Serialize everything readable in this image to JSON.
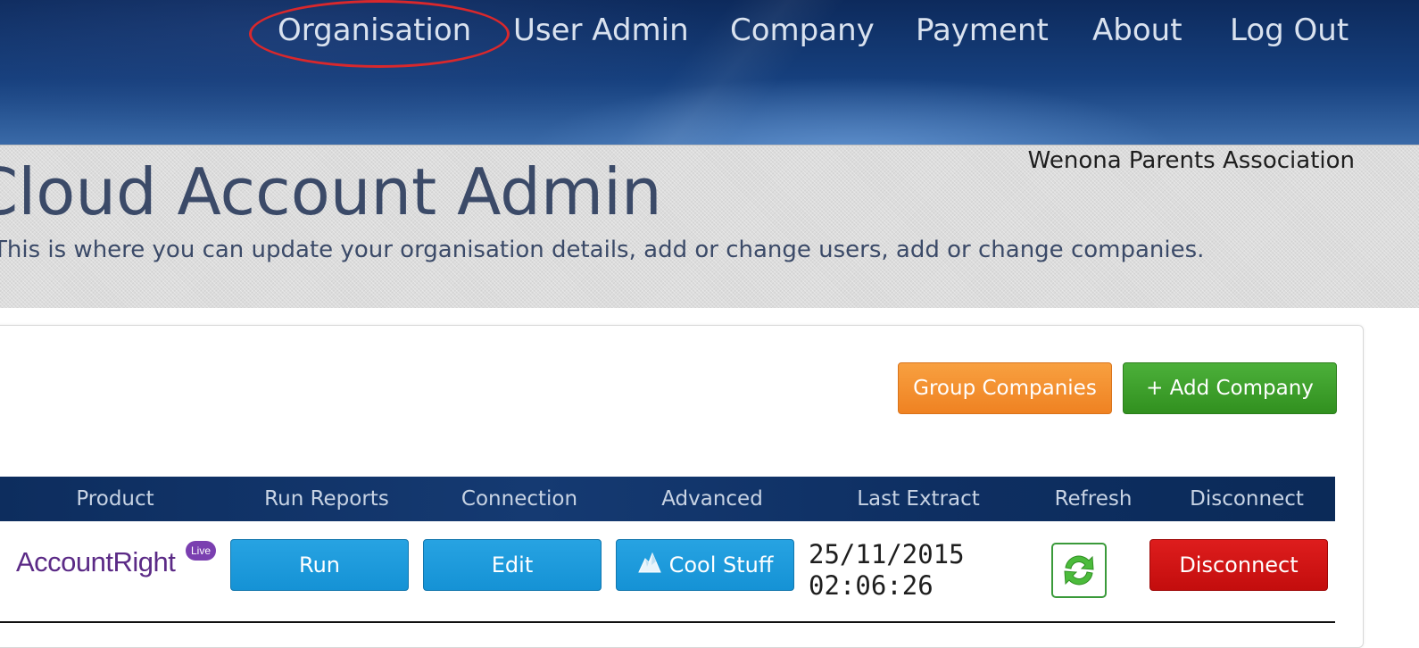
{
  "nav": {
    "organisation": "Organisation",
    "user_admin": "User Admin",
    "company": "Company",
    "payment": "Payment",
    "about": "About",
    "log_out": "Log Out"
  },
  "organisation_name": "Wenona Parents Association",
  "page": {
    "title": "Cloud Account Admin",
    "subtitle": "This is where you can update your organisation details, add or change users, add or change companies."
  },
  "actions": {
    "group_companies": "Group Companies",
    "add_company": "+ Add Company"
  },
  "table": {
    "columns": [
      "Product",
      "Run Reports",
      "Connection",
      "Advanced",
      "Last Extract",
      "Refresh",
      "Disconnect"
    ],
    "rows": [
      {
        "product": "AccountRight",
        "product_badge": "Live",
        "run_label": "Run",
        "edit_label": "Edit",
        "advanced_label": "Cool Stuff",
        "last_extract_date": "25/11/2015",
        "last_extract_time": "02:06:26",
        "disconnect_label": "Disconnect"
      }
    ]
  },
  "colors": {
    "header_bg": "#16407e",
    "highlight": "#d9282c",
    "orange": "#ef8222",
    "green": "#31901f",
    "blue": "#1592d5",
    "red": "#c30d0d",
    "brand_purple": "#5b2a86"
  },
  "icons": {
    "refresh": "refresh-arrows-icon",
    "advanced": "iceberg-icon"
  }
}
